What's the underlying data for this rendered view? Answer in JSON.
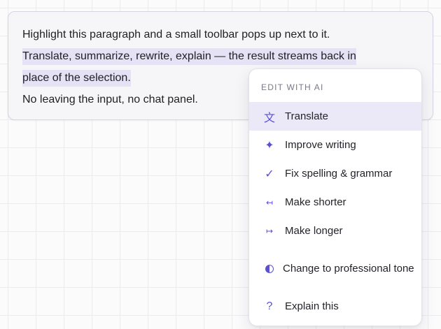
{
  "editor": {
    "line1": "Highlight this paragraph and a small toolbar pops up next to it.",
    "selected_line1": "Translate, summarize, rewrite, explain — the result streams back in",
    "selected_line2": "place of the selection.",
    "line3": "No leaving the input, no chat panel."
  },
  "menu": {
    "header": "EDIT WITH AI",
    "items": [
      {
        "label": "Translate",
        "icon": "translate-icon",
        "glyph": "文",
        "active": true
      },
      {
        "label": "Improve writing",
        "icon": "sparkle-icon",
        "glyph": "✦"
      },
      {
        "label": "Fix spelling & grammar",
        "icon": "checkmark-icon",
        "glyph": "✓"
      },
      {
        "label": "Make shorter",
        "icon": "shorten-arrows-icon",
        "glyph": "↤"
      },
      {
        "label": "Make longer",
        "icon": "lengthen-arrow-icon",
        "glyph": "↦"
      },
      {
        "label": "Change to professional tone",
        "icon": "half-circle-tone-icon",
        "glyph": ""
      },
      {
        "label": "Explain this",
        "icon": "question-mark-icon",
        "glyph": "?"
      }
    ]
  },
  "colors": {
    "accent": "#5b4fd3",
    "selection": "#e5e2f6",
    "active_item": "#ebe9f8"
  }
}
